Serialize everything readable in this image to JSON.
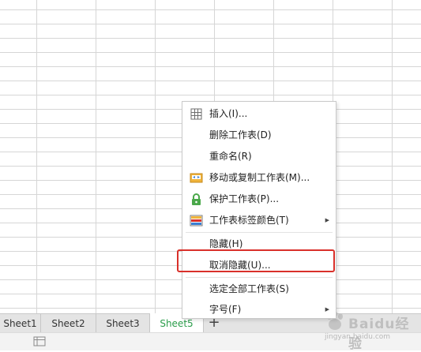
{
  "sheet_tabs": [
    {
      "label": "Sheet1"
    },
    {
      "label": "Sheet2"
    },
    {
      "label": "Sheet3"
    },
    {
      "label": "Sheet5",
      "active": true
    }
  ],
  "add_tab_label": "+",
  "context_menu": {
    "items": [
      {
        "label": "插入(I)...",
        "icon": "insert-table-icon"
      },
      {
        "label": "删除工作表(D)"
      },
      {
        "label": "重命名(R)"
      },
      {
        "label": "移动或复制工作表(M)...",
        "icon": "move-copy-icon"
      },
      {
        "label": "保护工作表(P)...",
        "icon": "lock-icon"
      },
      {
        "label": "工作表标签颜色(T)",
        "icon": "tab-color-icon",
        "submenu": true
      },
      {
        "label": "隐藏(H)"
      },
      {
        "label": "取消隐藏(U)...",
        "highlighted": true
      },
      {
        "label": "选定全部工作表(S)"
      },
      {
        "label": "字号(F)",
        "submenu": true
      }
    ]
  },
  "watermark": {
    "text": "Baidu经验",
    "url": "jingyan.baidu.com"
  },
  "colors": {
    "active_tab_text": "#2a9d4a",
    "highlight_border": "#d9302a",
    "tab_bar": "#e4e4e4",
    "grid_line": "#d6d6d6"
  }
}
